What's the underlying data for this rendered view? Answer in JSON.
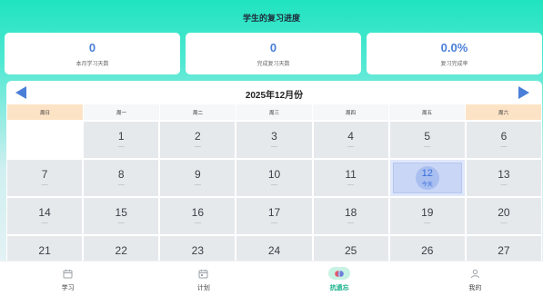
{
  "header": {
    "title": "学生的复习进度"
  },
  "stats": [
    {
      "value": "0",
      "label": "本月学习天数"
    },
    {
      "value": "0",
      "label": "完成复习天数"
    },
    {
      "value": "0.0%",
      "label": "复习完成率"
    }
  ],
  "calendar": {
    "month_label": "2025年12月份",
    "weekdays": [
      "周日",
      "周一",
      "周二",
      "周三",
      "周四",
      "周五",
      "周六"
    ],
    "dash": "—",
    "today_label": "今天",
    "rows": [
      [
        "",
        "1",
        "2",
        "3",
        "4",
        "5",
        "6"
      ],
      [
        "7",
        "8",
        "9",
        "10",
        "11",
        "12",
        "13"
      ],
      [
        "14",
        "15",
        "16",
        "17",
        "18",
        "19",
        "20"
      ],
      [
        "21",
        "22",
        "23",
        "24",
        "25",
        "26",
        "27"
      ]
    ]
  },
  "tabbar": {
    "items": [
      {
        "label": "学习",
        "icon": "calendar-icon"
      },
      {
        "label": "计划",
        "icon": "calendar-plan-icon"
      },
      {
        "label": "抗遗忘",
        "icon": "brain-icon"
      },
      {
        "label": "我的",
        "icon": "user-icon"
      }
    ]
  },
  "colors": {
    "accent": "#4a7fd8",
    "active_tab": "#0fae86",
    "weekend": "#fde3c6"
  }
}
